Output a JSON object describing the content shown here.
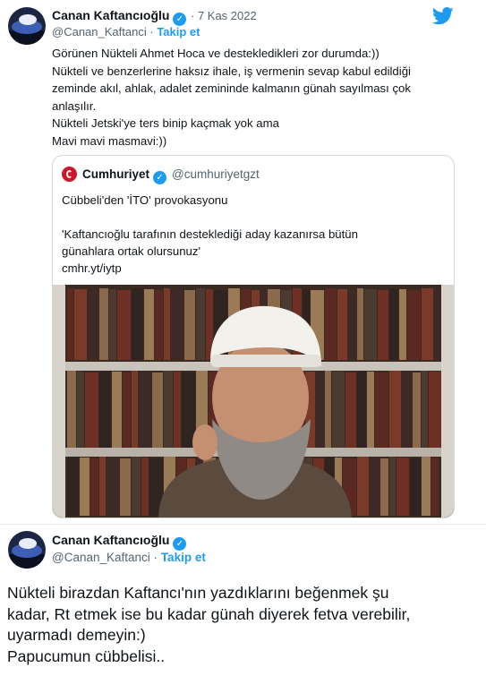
{
  "tweet1": {
    "author_name": "Canan Kaftancıoğlu",
    "date": "· 7 Kas 2022",
    "handle": "@Canan_Kaftanci",
    "separator": "·",
    "follow_label": "Takip et",
    "text_lines": [
      "Görünen  Nükteli Ahmet Hoca ve destekledikleri zor durumda:))",
      "Nükteli ve benzerlerine haksız ihale, iş vermenin sevap kabul edildiği",
      "zeminde akıl, ahlak, adalet zemininde kalmanın günah sayılması çok",
      "anlaşılır.",
      "Nükteli Jetski'ye ters binip kaçmak yok ama",
      "Mavi mavi masmavi:))"
    ],
    "quote": {
      "source_name": "Cumhuriyet",
      "verified_mark": "✓",
      "source_handle": "@cumhuriyetgzt",
      "headline": "Cübbeli'den 'İTO' provokasyonu",
      "excerpt_lines": [
        "'Kaftancıoğlu tarafının desteklediği aday kazanırsa bütün",
        "günahlara ortak olursunuz'"
      ],
      "link": "cmhr.yt/iytp"
    }
  },
  "tweet2": {
    "author_name": "Canan Kaftancıoğlu",
    "handle": "@Canan_Kaftanci",
    "separator": "·",
    "follow_label": "Takip et",
    "text_lines": [
      "Nükteli birazdan Kaftancı'nın yazdıklarını beğenmek şu",
      "kadar, Rt etmek ise  bu kadar günah diyerek fetva verebilir,",
      "uyarmadı demeyin:)",
      "Papucumun cübbelisi.."
    ]
  },
  "icons": {
    "verified": "verified-badge-icon",
    "twitter": "twitter-bird-icon",
    "source_logo": "cumhuriyet-logo-icon"
  },
  "colors": {
    "accent": "#1d9bf0",
    "text": "#0f1419",
    "muted": "#536471",
    "border": "#cfd9de",
    "brand_red": "#d0152b"
  },
  "verified_mark": "✓"
}
